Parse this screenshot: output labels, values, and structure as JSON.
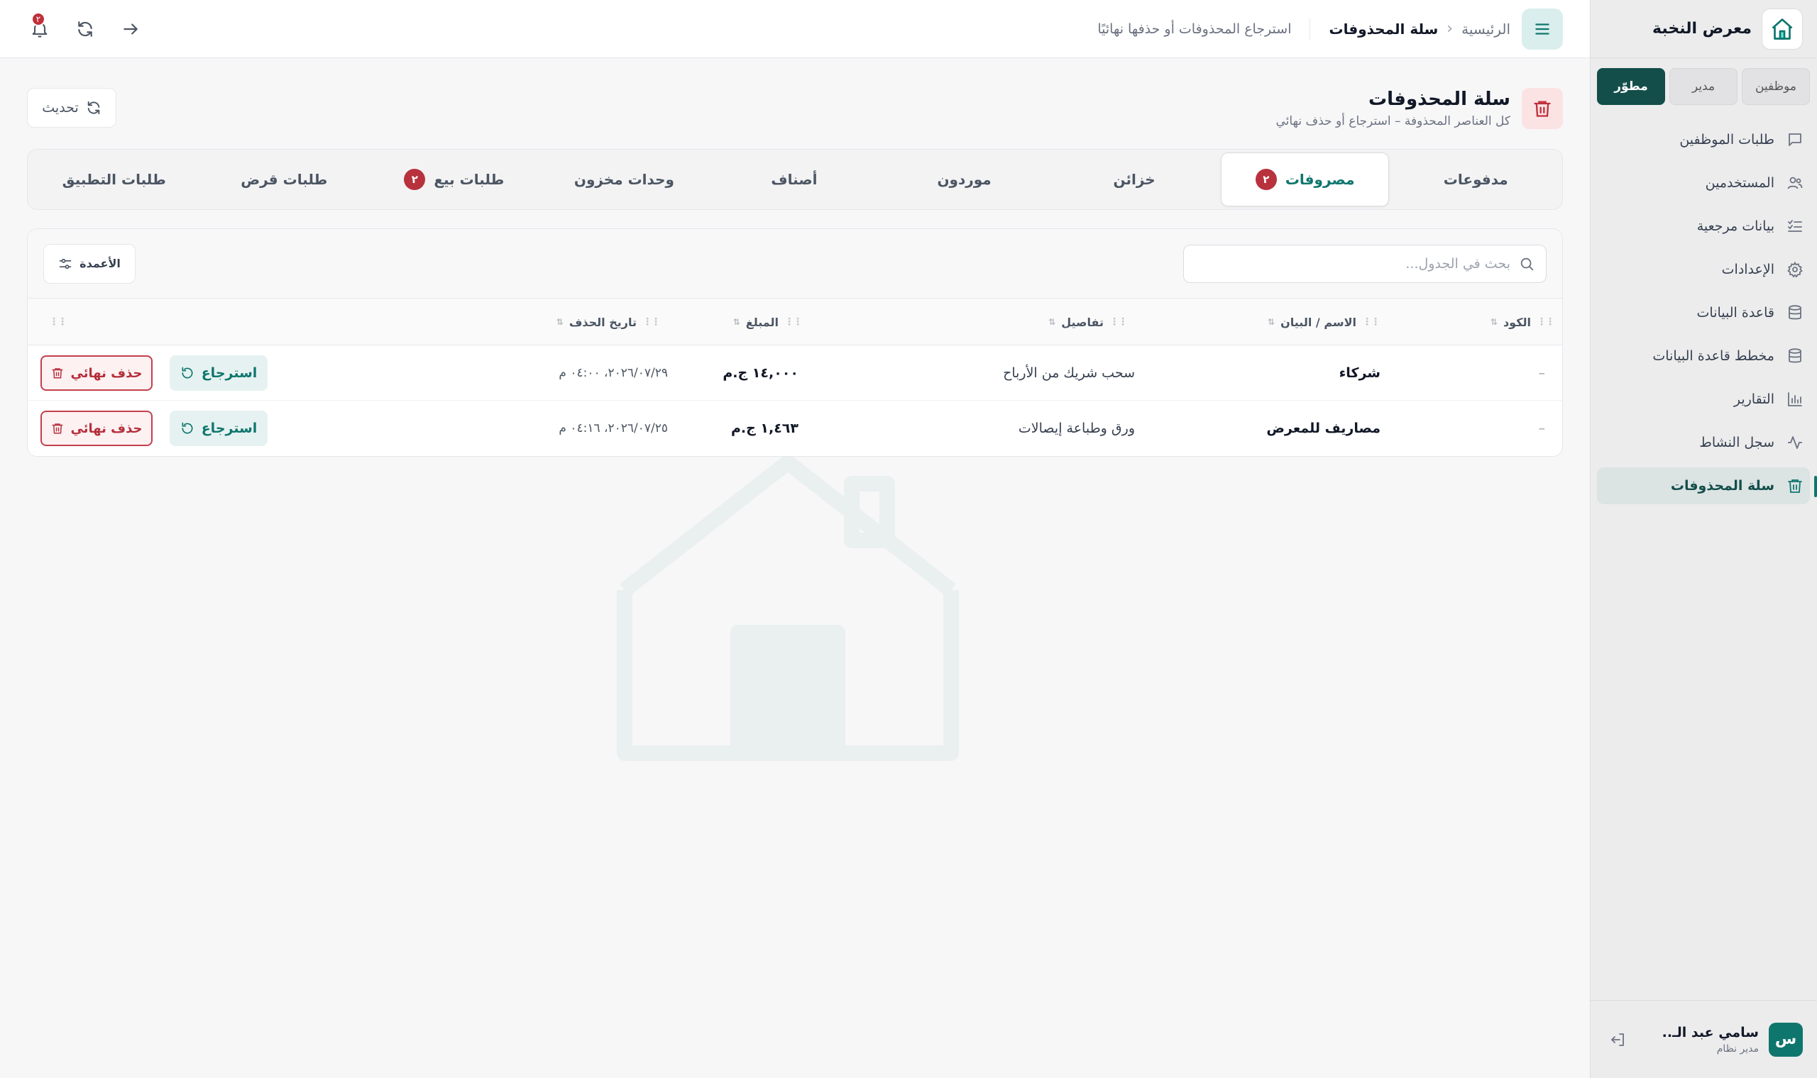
{
  "brand": {
    "name": "معرض النخبة",
    "logo_icon": "house-logo-icon"
  },
  "roles": [
    {
      "label": "موظفين",
      "active": false
    },
    {
      "label": "مدير",
      "active": false
    },
    {
      "label": "مطوّر",
      "active": true
    }
  ],
  "nav": [
    {
      "label": "طلبات الموظفين",
      "icon": "message-square-icon"
    },
    {
      "label": "المستخدمين",
      "icon": "users-icon"
    },
    {
      "label": "بيانات مرجعية",
      "icon": "list-checks-icon"
    },
    {
      "label": "الإعدادات",
      "icon": "gear-icon"
    },
    {
      "label": "قاعدة البيانات",
      "icon": "database-icon"
    },
    {
      "label": "مخطط قاعدة البيانات",
      "icon": "database-schema-icon"
    },
    {
      "label": "التقارير",
      "icon": "bar-chart-icon"
    },
    {
      "label": "سجل النشاط",
      "icon": "activity-icon"
    },
    {
      "label": "سلة المحذوفات",
      "icon": "trash-icon",
      "active": true
    }
  ],
  "user": {
    "initial": "س",
    "name": "سامي عبد الـ..",
    "role": "مدير نظام"
  },
  "header": {
    "home": "الرئيسية",
    "current": "سلة المحذوفات",
    "subtitle": "استرجاع المحذوفات أو حذفها نهائيًا",
    "notifications_count": "٢"
  },
  "page": {
    "title": "سلة المحذوفات",
    "subtitle": "كل العناصر المحذوفة – استرجاع أو حذف نهائي",
    "refresh_label": "تحديث"
  },
  "tabs": [
    {
      "label": "مدفوعات",
      "badge": null,
      "active": false
    },
    {
      "label": "مصروفات",
      "badge": "٢",
      "active": true
    },
    {
      "label": "خزائن",
      "badge": null,
      "active": false
    },
    {
      "label": "موردون",
      "badge": null,
      "active": false
    },
    {
      "label": "أصناف",
      "badge": null,
      "active": false
    },
    {
      "label": "وحدات مخزون",
      "badge": null,
      "active": false
    },
    {
      "label": "طلبات بيع",
      "badge": "٢",
      "active": false
    },
    {
      "label": "طلبات قرض",
      "badge": null,
      "active": false
    },
    {
      "label": "طلبات التطبيق",
      "badge": null,
      "active": false
    }
  ],
  "table": {
    "search_placeholder": "بحث في الجدول...",
    "columns_label": "الأعمدة",
    "headers": {
      "code": "الكود",
      "name": "الاسم / البيان",
      "details": "تفاصيل",
      "amount": "المبلغ",
      "deleted_at": "تاريخ الحذف"
    },
    "rows": [
      {
        "code": "–",
        "name": "شركاء",
        "details": "سحب شريك من الأرباح",
        "amount": "١٤,٠٠٠ ج.م",
        "deleted_at": "٢٠٢٦/٠٧/٢٩، ٠٤:٠٠ م"
      },
      {
        "code": "–",
        "name": "مصاريف للمعرض",
        "details": "ورق وطباعة إيصالات",
        "amount": "١,٤٦٣ ج.م",
        "deleted_at": "٢٠٢٦/٠٧/٢٥، ٠٤:١٦ م"
      }
    ],
    "restore_label": "استرجاع",
    "delete_label": "حذف نهائي"
  },
  "colors": {
    "accent": "#0f766e",
    "danger": "#b42f3b",
    "sidebar_bg": "#ececed"
  }
}
